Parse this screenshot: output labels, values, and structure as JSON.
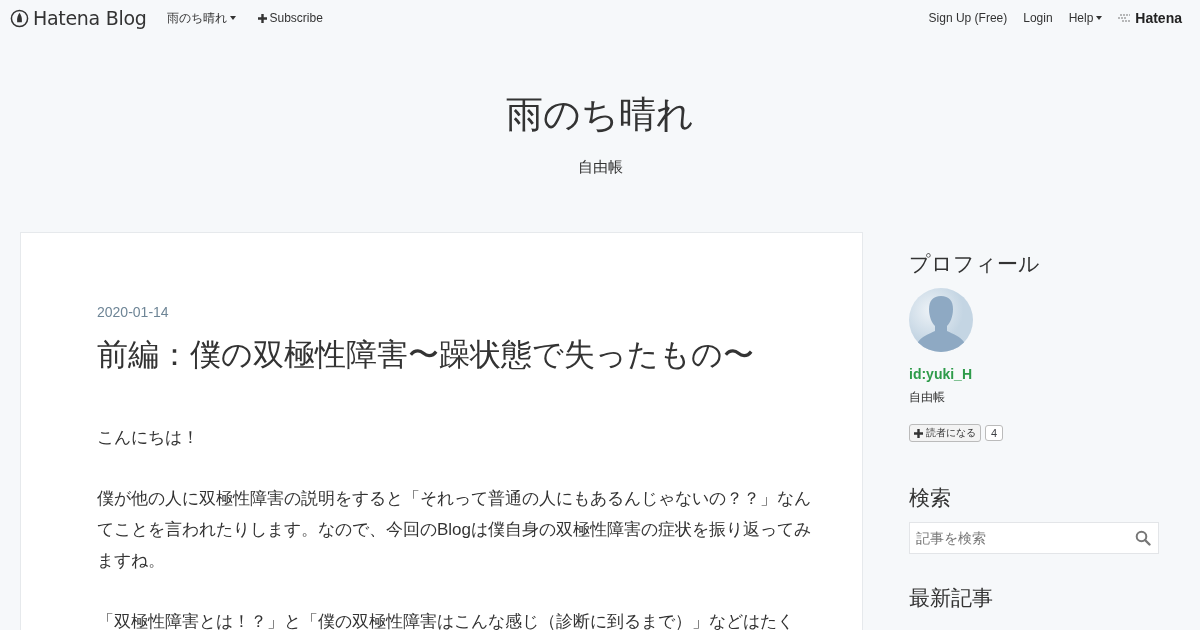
{
  "navbar": {
    "brand": "Hatena Blog",
    "blog_menu": "雨のち晴れ",
    "subscribe": "Subscribe",
    "links": [
      "Sign Up (Free)",
      "Login"
    ],
    "help": "Help",
    "company": "Hatena"
  },
  "header": {
    "title": "雨のち晴れ",
    "description": "自由帳"
  },
  "article": {
    "date": "2020-01-14",
    "title": "前編：僕の双極性障害〜躁状態で失ったもの〜",
    "paragraphs": [
      "こんにちは！",
      "僕が他の人に双極性障害の説明をすると「それって普通の人にもあるんじゃないの？？」なんてことを言われたりします。なので、今回のBlogは僕自身の双極性障害の症状を振り返ってみますね。",
      "「双極性障害とは！？」と「僕の双極性障害はこんな感じ（診断に到るまで）」などはたく"
    ]
  },
  "sidebar": {
    "profile": {
      "heading": "プロフィール",
      "user_id": "id:yuki_H",
      "description": "自由帳",
      "subscribe_label": "読者になる",
      "subscriber_count": "4"
    },
    "search": {
      "heading": "検索",
      "placeholder": "記事を検索"
    },
    "recent": {
      "heading": "最新記事"
    }
  }
}
